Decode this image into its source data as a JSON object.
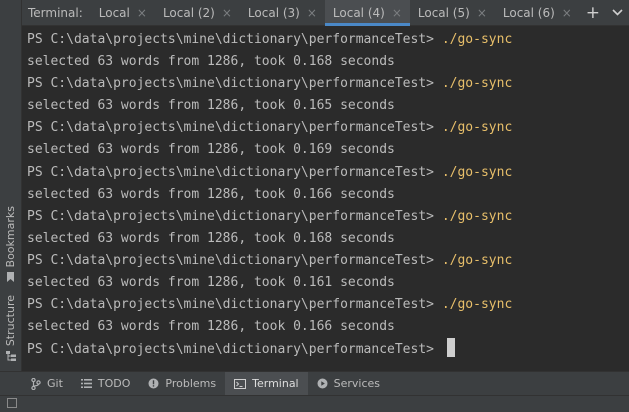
{
  "terminal_tabs": {
    "title": "Terminal:",
    "tabs": [
      {
        "label": "Local"
      },
      {
        "label": "Local (2)"
      },
      {
        "label": "Local (3)"
      },
      {
        "label": "Local (4)",
        "active": true
      },
      {
        "label": "Local (5)"
      },
      {
        "label": "Local (6)"
      }
    ],
    "close_glyph": "×",
    "new_tab_glyph": "+",
    "more_glyph": "⌄"
  },
  "sidebar": {
    "bookmarks_label": "Bookmarks",
    "structure_label": "Structure"
  },
  "terminal": {
    "prompt": "PS C:\\data\\projects\\mine\\dictionary\\performanceTest> ",
    "command": "./go-sync",
    "lines": [
      {
        "output": "selected 63 words from 1286, took 0.168 seconds"
      },
      {
        "output": "selected 63 words from 1286, took 0.165 seconds"
      },
      {
        "output": "selected 63 words from 1286, took 0.169 seconds"
      },
      {
        "output": "selected 63 words from 1286, took 0.166 seconds"
      },
      {
        "output": "selected 63 words from 1286, took 0.168 seconds"
      },
      {
        "output": "selected 63 words from 1286, took 0.161 seconds"
      },
      {
        "output": "selected 63 words from 1286, took 0.166 seconds"
      }
    ]
  },
  "tool_windows": {
    "git": "Git",
    "todo": "TODO",
    "problems": "Problems",
    "terminal": "Terminal",
    "services": "Services"
  },
  "colors": {
    "background": "#2b2b2b",
    "panel": "#3c3f41",
    "command": "#e8bf6a",
    "active_underline": "#4a88c7"
  }
}
